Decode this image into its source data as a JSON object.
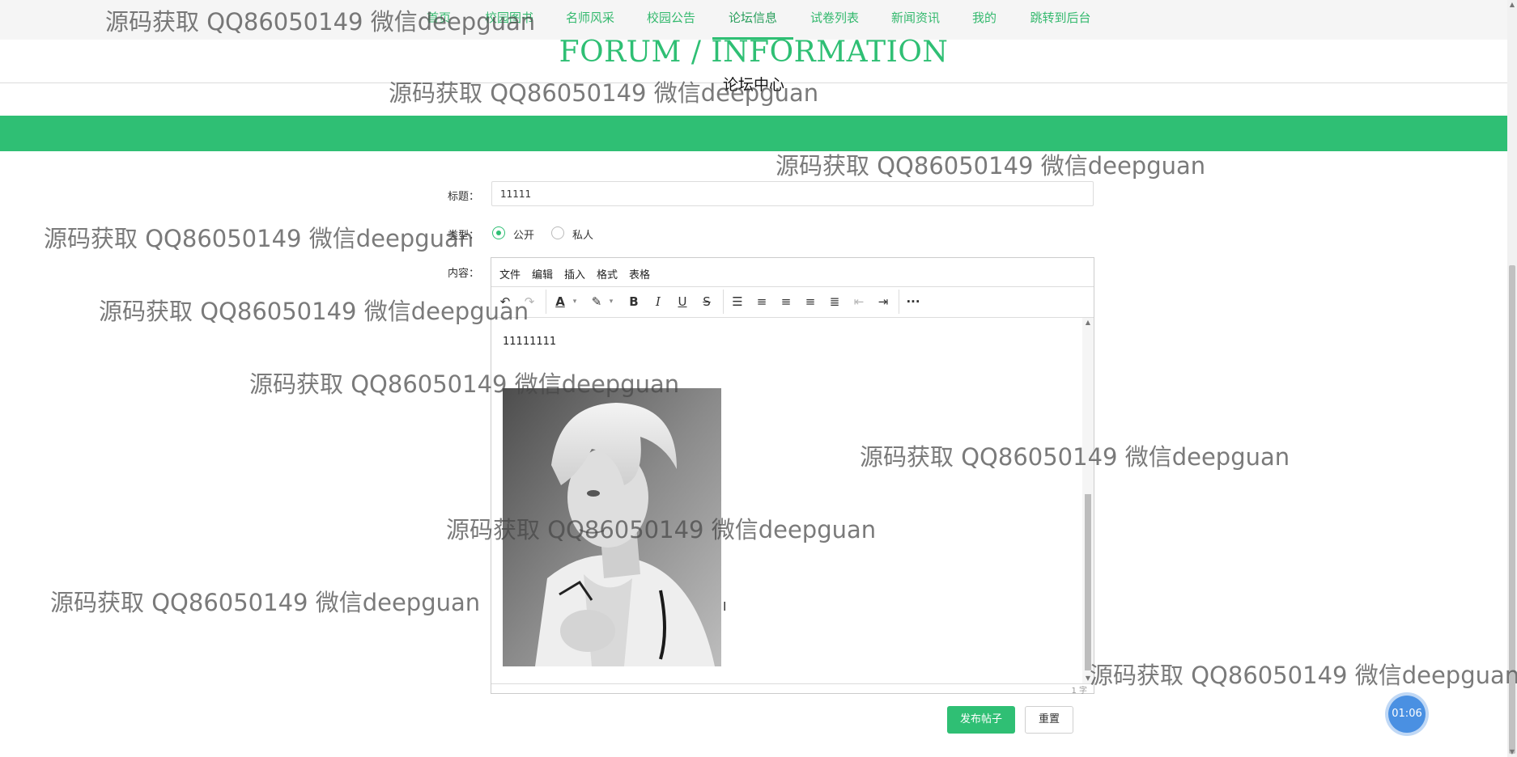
{
  "nav": {
    "items": [
      {
        "label": "首页",
        "active": false
      },
      {
        "label": "校园图书",
        "active": false
      },
      {
        "label": "名师风采",
        "active": false
      },
      {
        "label": "校园公告",
        "active": false
      },
      {
        "label": "论坛信息",
        "active": true
      },
      {
        "label": "试卷列表",
        "active": false
      },
      {
        "label": "新闻资讯",
        "active": false
      },
      {
        "label": "我的",
        "active": false
      },
      {
        "label": "跳转到后台",
        "active": false
      }
    ]
  },
  "page": {
    "title_en": "FORUM / INFORMATION",
    "title_cn": "论坛中心"
  },
  "form": {
    "title_label": "标题：",
    "title_value": "11111",
    "type_label": "类型：",
    "type_options": [
      {
        "label": "公开",
        "checked": true
      },
      {
        "label": "私人",
        "checked": false
      }
    ],
    "content_label": "内容："
  },
  "editor": {
    "menus": [
      "文件",
      "编辑",
      "插入",
      "格式",
      "表格"
    ],
    "toolbar_icons": [
      "undo-icon",
      "redo-icon",
      "font-color-icon",
      "highlight-icon",
      "bold-icon",
      "italic-icon",
      "underline-icon",
      "strikethrough-icon",
      "list-icon",
      "align-left-icon",
      "align-center-icon",
      "align-right-icon",
      "justify-icon",
      "outdent-icon",
      "indent-icon",
      "more-icon"
    ],
    "content_text": "11111111",
    "word_count": "1 字"
  },
  "buttons": {
    "submit": "发布帖子",
    "reset": "重置"
  },
  "timer": "01:06",
  "watermark": "源码获取 QQ86050149 微信deepguan",
  "colors": {
    "accent": "#2fbf74",
    "nav_text": "#34b96e",
    "timer": "#4a90e2"
  }
}
